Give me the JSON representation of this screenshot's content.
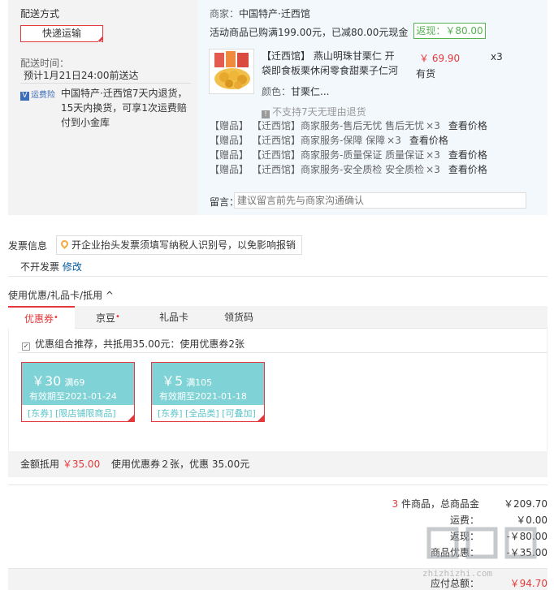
{
  "delivery": {
    "title": "配送方式",
    "method_button": "快递运输",
    "time_label": "配送时间：",
    "time_value": "预计1月21日24:00前送达",
    "insurance_label": "运费险",
    "insurance_text_1": "中国特产·迁西馆7天内退货，",
    "insurance_text_2": "15天内换货，可享1次运费赔",
    "insurance_text_3": "付到小金库"
  },
  "shop": {
    "merchant_label": "商家：",
    "merchant_name": "中国特产·迁西馆",
    "promo_text": "活动商品已购满199.00元，已减80.00元现金",
    "rebate": "返现：￥80.00"
  },
  "product": {
    "title_line_1": "【迁西馆】 燕山明珠甘栗仁 开",
    "title_line_2": "袋即食板栗休闲零食甜栗子仁河",
    "color_label": "颜色：",
    "color_value": "甘栗仁...",
    "price": "￥ 69.90",
    "qty": "x3",
    "stock": "有货",
    "no_return": "不支持7天无理由退货"
  },
  "gifts": [
    {
      "tag": "【赠品】",
      "name": "【迁西馆】商家服务-售后无忧 售后无忧",
      "qty": "×3",
      "link": "查看价格"
    },
    {
      "tag": "【赠品】",
      "name": "【迁西馆】商家服务-保障 保障",
      "qty": "×3",
      "link": "查看价格"
    },
    {
      "tag": "【赠品】",
      "name": "【迁西馆】商家服务-质量保证 质量保证",
      "qty": "×3",
      "link": "查看价格"
    },
    {
      "tag": "【赠品】",
      "name": "【迁西馆】商家服务-安全质检 安全质检",
      "qty": "×3",
      "link": "查看价格"
    }
  ],
  "message": {
    "label": "留言：",
    "placeholder": "建议留言前先与商家沟通确认"
  },
  "invoice": {
    "title": "发票信息",
    "tip": "开企业抬头发票须填写纳税人识别号，以免影响报销",
    "status": "不开发票",
    "edit": "修改"
  },
  "discount": {
    "title": "使用优惠/礼品卡/抵用",
    "tabs": [
      "优惠券",
      "京豆",
      "礼品卡",
      "领货码"
    ],
    "combo_text": "优惠组合推荐，共抵用35.00元：使用优惠券2张",
    "coupons": [
      {
        "amount": "￥30",
        "cond": "满69",
        "valid": "有效期至2021-01-24",
        "tags": "[东券] [限店铺限商品]"
      },
      {
        "amount": "￥5",
        "cond": "满105",
        "valid": "有效期至2021-01-18",
        "tags": "[东券] [全品类] [可叠加]"
      }
    ],
    "summary_label": "金额抵用",
    "summary_amount": "￥35.00",
    "summary_text": "使用优惠券２张，优惠 35.00元"
  },
  "totals": {
    "count": "3",
    "count_suffix": "件商品，总商品金",
    "goods_total": "￥209.70",
    "freight_label": "运费：",
    "freight_value": "￥0.00",
    "promo_label": "返现：",
    "promo_value": "-￥80.00",
    "coupon_label": "商品优惠：",
    "coupon_value": "-￥35.00",
    "pay_label": "应付总额：",
    "pay_value": "￥94.70"
  },
  "watermark": "zhizhizhi.com",
  "colors": {
    "accent": "#e4393c",
    "coupon": "#7fd3d6",
    "rebate": "#56b151",
    "link": "#005aa0"
  }
}
